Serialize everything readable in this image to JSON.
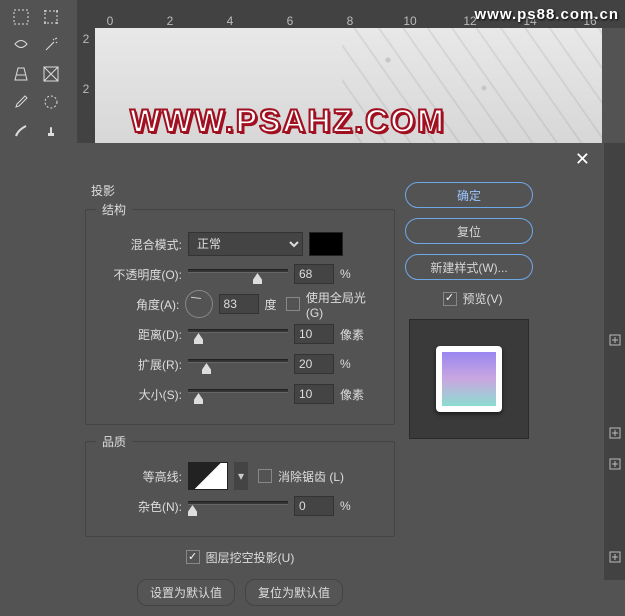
{
  "watermark": "www.ps88.com.cn",
  "logo_text": "WWW.PSAHZ.COM",
  "ruler_h": [
    "0",
    "",
    "2",
    "",
    "4",
    "",
    "6",
    "",
    "8",
    "",
    "10",
    "",
    "12",
    "",
    "14",
    "",
    "16"
  ],
  "ruler_v": [
    "2",
    "2"
  ],
  "dialog": {
    "title": "投影",
    "structure_legend": "结构",
    "quality_legend": "品质",
    "blend_mode_label": "混合模式:",
    "blend_mode_value": "正常",
    "opacity_label": "不透明度(O):",
    "opacity_value": "68",
    "opacity_unit": "%",
    "angle_label": "角度(A):",
    "angle_value": "83",
    "angle_unit": "度",
    "global_light_label": "使用全局光 (G)",
    "distance_label": "距离(D):",
    "distance_value": "10",
    "distance_unit": "像素",
    "spread_label": "扩展(R):",
    "spread_value": "20",
    "spread_unit": "%",
    "size_label": "大小(S):",
    "size_value": "10",
    "size_unit": "像素",
    "contour_label": "等高线:",
    "antialias_label": "消除锯齿 (L)",
    "noise_label": "杂色(N):",
    "noise_value": "0",
    "noise_unit": "%",
    "knockout_label": "图层挖空投影(U)",
    "make_default": "设置为默认值",
    "reset_default": "复位为默认值",
    "ok": "确定",
    "reset": "复位",
    "new_style": "新建样式(W)...",
    "preview_label": "预览(V)"
  },
  "slider_pos": {
    "opacity": 65,
    "distance": 6,
    "spread": 14,
    "size": 6,
    "noise": 0
  }
}
